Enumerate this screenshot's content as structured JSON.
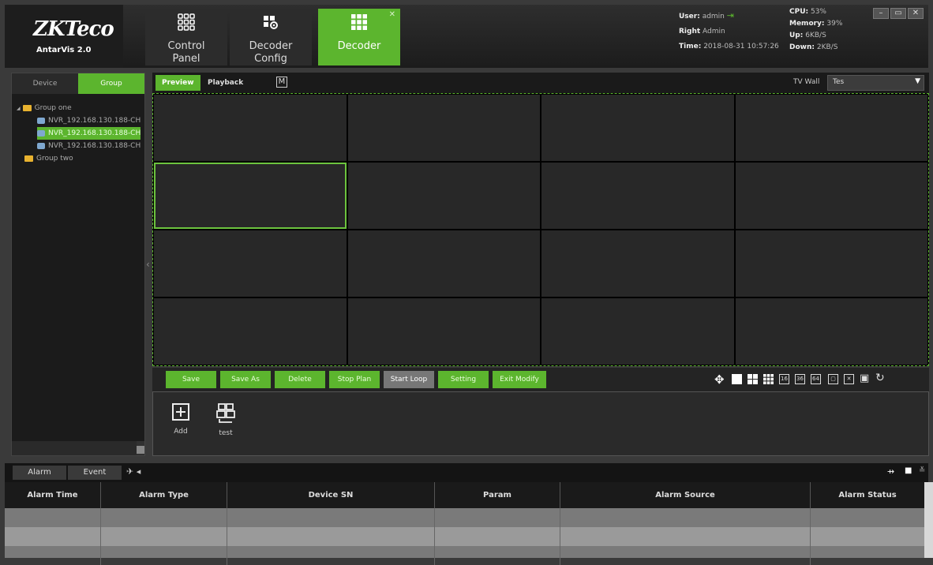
{
  "app": {
    "brand": "ZKTeco",
    "version": "AntarVis 2.0"
  },
  "nav_tabs": [
    {
      "label": "Control\nPanel",
      "icon": "grid-apps-icon"
    },
    {
      "label": "Decoder\nConfig",
      "icon": "decoder-config-icon"
    },
    {
      "label": "Decoder",
      "icon": "decoder-icon",
      "active": true
    }
  ],
  "status": {
    "user_label": "User:",
    "user": "admin",
    "right_label": "Right",
    "right": "Admin",
    "time_label": "Time:",
    "time": "2018-08-31 10:57:26",
    "cpu_label": "CPU:",
    "cpu": "53%",
    "memory_label": "Memory:",
    "memory": "39%",
    "up_label": "Up:",
    "up": "6KB/S",
    "down_label": "Down:",
    "down": "2KB/S"
  },
  "left_tabs": [
    "Device",
    "Group"
  ],
  "tree": [
    {
      "type": "folder",
      "label": "Group one",
      "expanded": true
    },
    {
      "type": "camera",
      "label": "NVR_192.168.130.188-CH"
    },
    {
      "type": "camera",
      "label": "NVR_192.168.130.188-CH",
      "selected": true
    },
    {
      "type": "camera",
      "label": "NVR_192.168.130.188-CH"
    },
    {
      "type": "folder",
      "label": "Group two"
    }
  ],
  "preview_tabs": [
    "Preview",
    "Playback",
    "M"
  ],
  "tvwall": {
    "label": "TV Wall",
    "value": "Tes"
  },
  "buttons": [
    "Save",
    "Save As",
    "Delete",
    "Stop Plan",
    "Start Loop",
    "Setting",
    "Exit Modify"
  ],
  "layout_icons": [
    "1",
    "4",
    "9",
    "16",
    "36",
    "64"
  ],
  "plans": [
    {
      "label": "Add",
      "icon": "add-plan-icon"
    },
    {
      "label": "test",
      "icon": "plan-layout-icon"
    }
  ],
  "alarm_tabs": [
    "Alarm",
    "Event"
  ],
  "table": {
    "columns": [
      "Alarm Time",
      "Alarm Type",
      "Device SN",
      "Param",
      "Alarm Source",
      "Alarm Status"
    ],
    "rows": [
      [
        "",
        "",
        "",
        "",
        "",
        ""
      ],
      [
        "",
        "",
        "",
        "",
        "",
        ""
      ],
      [
        "",
        "",
        "",
        "",
        "",
        ""
      ]
    ]
  },
  "colors": {
    "accent": "#5cb52e",
    "bg": "#3a3a3a"
  }
}
